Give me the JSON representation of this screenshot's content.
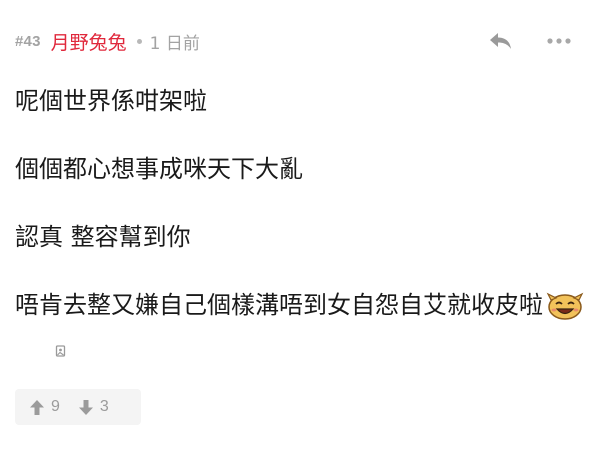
{
  "post": {
    "floor": "#43",
    "username": "月野兔兔",
    "time": "1 日前",
    "paragraphs": [
      "呢個世界係咁架啦",
      "個個都心想事成咪天下大亂",
      "認真 整容幫到你",
      "唔肯去整又嫌自己個樣溝唔到女自怨自艾就收皮啦"
    ],
    "upvotes": "9",
    "downvotes": "3"
  },
  "icons": {
    "reply": "reply-arrow-icon",
    "more": "more-dots-icon",
    "upvote": "arrow-up-icon",
    "downvote": "arrow-down-icon",
    "sticker": "laughing-face-sticker",
    "broken_image": "broken-image-icon"
  },
  "colors": {
    "username": "#e0283c",
    "meta_gray": "#a3a3a3",
    "vote_bg": "#f4f4f4"
  }
}
